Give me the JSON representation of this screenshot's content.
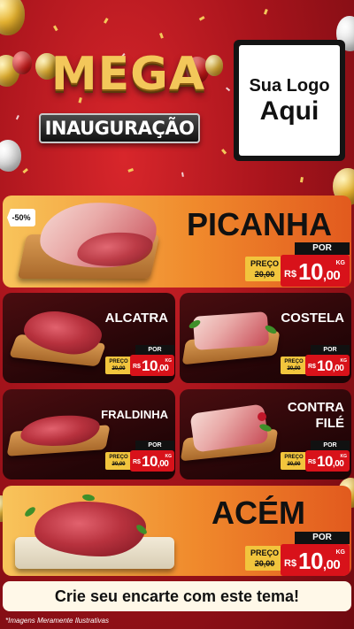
{
  "header": {
    "title_line1": "MEGA",
    "title_line2": "INAUGURAÇÃO",
    "logo_line1": "Sua Logo",
    "logo_line2": "Aqui"
  },
  "labels": {
    "por": "POR",
    "preco": "PREÇO",
    "currency": "R$",
    "unit": "KG"
  },
  "products": [
    {
      "name": "PICANHA",
      "discount": "-50%",
      "old_price": "20,00",
      "price_int": "10",
      "price_dec": ",00"
    },
    {
      "name": "ALCATRA",
      "old_price": "20,00",
      "price_int": "10",
      "price_dec": ",00"
    },
    {
      "name": "COSTELA",
      "old_price": "20,00",
      "price_int": "10",
      "price_dec": ",00"
    },
    {
      "name": "FRALDINHA",
      "old_price": "20,00",
      "price_int": "10",
      "price_dec": ",00"
    },
    {
      "name_line1": "CONTRA",
      "name_line2": "FILÉ",
      "old_price": "20,00",
      "price_int": "10",
      "price_dec": ",00"
    },
    {
      "name": "ACÉM",
      "old_price": "20,00",
      "price_int": "10",
      "price_dec": ",00"
    }
  ],
  "footer": {
    "cta": "Crie seu encarte com este tema!",
    "disclaimer": "*Imagens Meramente Ilustrativas"
  },
  "colors": {
    "background": "#a8141c",
    "card_orange": "#f08a2c",
    "card_dark": "#240507",
    "price_red": "#d8121a",
    "preco_yellow": "#f2c53d"
  }
}
